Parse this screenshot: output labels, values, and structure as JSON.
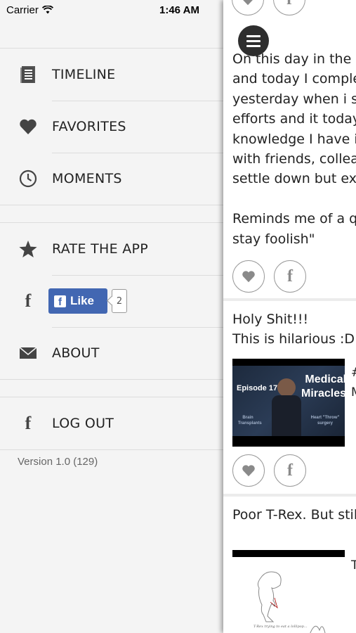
{
  "status_bar": {
    "carrier": "Carrier",
    "time": "1:46 AM"
  },
  "menu": {
    "items_group1": [
      {
        "label": "TIMELINE",
        "icon": "timeline-icon"
      },
      {
        "label": "FAVORITES",
        "icon": "heart-icon"
      },
      {
        "label": "MOMENTS",
        "icon": "clock-icon"
      }
    ],
    "items_group2": {
      "rate": {
        "label": "RATE THE APP",
        "icon": "star-icon"
      },
      "facebook_like": {
        "button_label": "Like",
        "count": "2",
        "icon": "facebook-icon"
      },
      "about": {
        "label": "ABOUT",
        "icon": "envelope-icon"
      }
    },
    "logout": {
      "label": "LOG OUT",
      "icon": "facebook-icon"
    },
    "version": "Version 1.0 (129)"
  },
  "feed": {
    "post1": {
      "lines": [
        "On this day in the y",
        "and today I comple",
        "yesterday when i st",
        "efforts and it today",
        "knowledge I have is",
        "with friends, collea",
        "settle down but exp",
        "",
        "Reminds me of a q",
        "stay foolish\""
      ]
    },
    "post2": {
      "lines": [
        "Holy Shit!!!",
        "This is hilarious :D:D"
      ],
      "thumb": {
        "title_line1": "Medical",
        "title_line2": "Miracles",
        "episode": "Episode 17",
        "left_caption": "Brain Transplants",
        "right_caption": "Heart \"Throw\" surgery"
      },
      "peek": [
        "#",
        "M"
      ]
    },
    "post3": {
      "lines": [
        "Poor T-Rex. But stil"
      ],
      "thumb_caption": "T-Rex trying to eat a lollipop...",
      "peek": "T"
    }
  },
  "colors": {
    "facebook_blue": "#4267b2",
    "menu_background": "#f4f4f4",
    "text": "#222222"
  }
}
